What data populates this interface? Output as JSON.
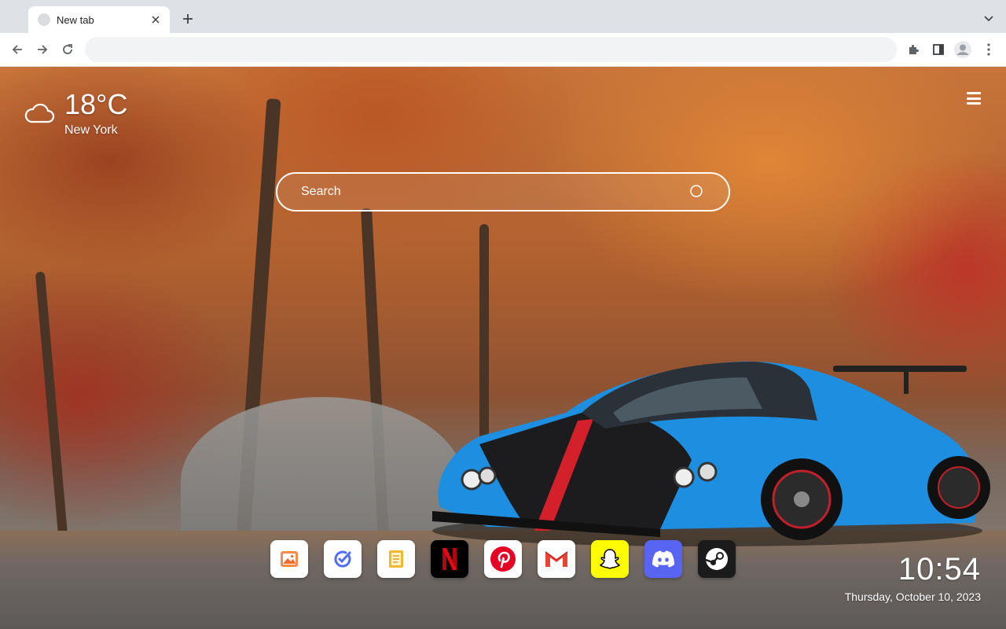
{
  "browser": {
    "tab": {
      "title": "New tab",
      "favicon": "globe-icon",
      "close_icon": "close-icon"
    },
    "new_tab_icon": "plus-icon",
    "tab_search_icon": "chevron-down-icon",
    "toolbar": {
      "back_icon": "back-arrow-icon",
      "forward_icon": "forward-arrow-icon",
      "reload_icon": "reload-icon",
      "address": "",
      "extensions_icon": "puzzle-icon",
      "sidepanel_icon": "side-panel-icon",
      "profile_icon": "avatar-icon",
      "menu_icon": "kebab-menu-icon"
    }
  },
  "weather": {
    "temperature": "18°C",
    "city": "New York",
    "icon": "cloud-icon"
  },
  "menu_icon": "hamburger-menu-icon",
  "search": {
    "placeholder": "Search",
    "value": "",
    "icon": "search-icon"
  },
  "apps": [
    {
      "name": "Photos",
      "icon": "image-icon",
      "bg": "#ffffff",
      "color": "#f06b2a"
    },
    {
      "name": "Todo",
      "icon": "check-circle-icon",
      "bg": "#ffffff",
      "color": "#4f6ef7"
    },
    {
      "name": "Notes",
      "icon": "notes-icon",
      "bg": "#ffffff",
      "color": "#f3b830"
    },
    {
      "name": "Netflix",
      "icon": "netflix-icon",
      "bg": "#000000",
      "color": "#e50914"
    },
    {
      "name": "Pinterest",
      "icon": "pinterest-icon",
      "bg": "#ffffff",
      "color": "#e60023"
    },
    {
      "name": "Gmail",
      "icon": "gmail-icon",
      "bg": "#ffffff",
      "color": "#ea4335"
    },
    {
      "name": "Snapchat",
      "icon": "snapchat-icon",
      "bg": "#fffc00",
      "color": "#ffffff"
    },
    {
      "name": "Discord",
      "icon": "discord-icon",
      "bg": "#5865f2",
      "color": "#ffffff"
    },
    {
      "name": "Steam",
      "icon": "steam-icon",
      "bg": "#1b1b1b",
      "color": "#ffffff"
    }
  ],
  "clock": {
    "time": "10:54",
    "date": "Thursday, October 10, 2023"
  }
}
